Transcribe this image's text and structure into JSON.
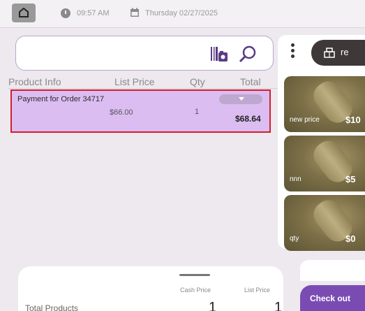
{
  "status": {
    "time": "09:57 AM",
    "date": "Thursday 02/27/2025",
    "icons": [
      "home-icon",
      "clock-icon",
      "calendar-icon"
    ]
  },
  "search": {
    "icons": [
      "barcode-scan-icon",
      "search-icon"
    ]
  },
  "table": {
    "headers": [
      "Product Info",
      "List Price",
      "Qty",
      "Total"
    ],
    "rows": [
      {
        "name": "Payment for Order 34717",
        "price": "$66.00",
        "qty": "1",
        "total": "$68.64"
      }
    ]
  },
  "right": {
    "pill_label": "re",
    "tiles": [
      {
        "name": "new price",
        "price": "$10"
      },
      {
        "name": "nnn",
        "price": "$5"
      },
      {
        "name": "qty",
        "price": "$0"
      }
    ]
  },
  "summary": {
    "cash_price_label": "Cash Price",
    "list_price_label": "List Price",
    "total_products_label": "Total Products",
    "cash_count": "1",
    "list_count": "1",
    "checkout_label": "Check out"
  },
  "colors": {
    "accent": "#7a4cb3",
    "selected_row": "#dcbdf2",
    "highlight_border": "#d11f2d"
  }
}
